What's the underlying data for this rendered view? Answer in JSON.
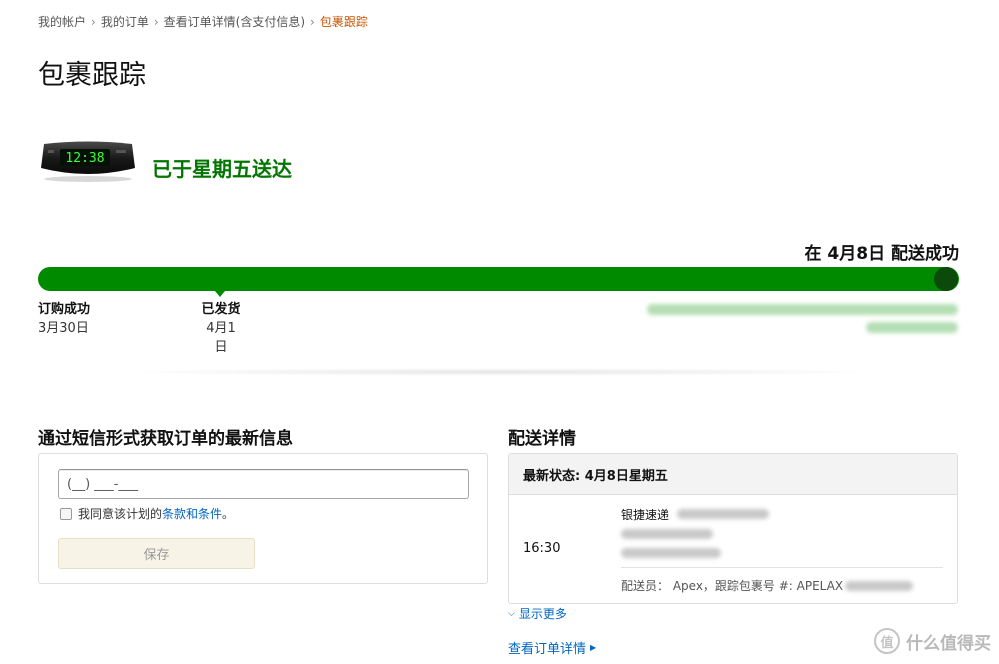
{
  "breadcrumb": {
    "items": [
      "我的帐户",
      "我的订单",
      "查看订单详情(含支付信息)",
      "包裹跟踪"
    ],
    "separator": "›"
  },
  "page_title": "包裹跟踪",
  "delivery_status": "已于星期五送达",
  "delivered_on": "在 4月8日 配送成功",
  "progress": {
    "fraction": 1.0,
    "color": "#008a00",
    "milestones": [
      {
        "label": "订购成功",
        "date": "3月30日"
      },
      {
        "label": "已发货",
        "date": "4月1日"
      }
    ]
  },
  "sms": {
    "heading": "通过短信形式获取订单的最新信息",
    "phone_placeholder": "(__) ___-___",
    "agree_prefix": "我同意该计划的",
    "terms_link": "条款和条件",
    "agree_suffix": "。",
    "save_label": "保存"
  },
  "shipping": {
    "heading": "配送详情",
    "latest_status": "最新状态: 4月8日星期五",
    "event_time": "16:30",
    "carrier": "银捷速递",
    "courier_line": "配送员： Apex，跟踪包裹号 #: APELAX"
  },
  "show_more": "显示更多",
  "order_details_link": "查看订单详情",
  "watermark": "什么值得买",
  "colors": {
    "accent_green": "#008a00",
    "status_green": "#007600",
    "link_blue": "#0066c0",
    "breadcrumb_current": "#c45500"
  }
}
